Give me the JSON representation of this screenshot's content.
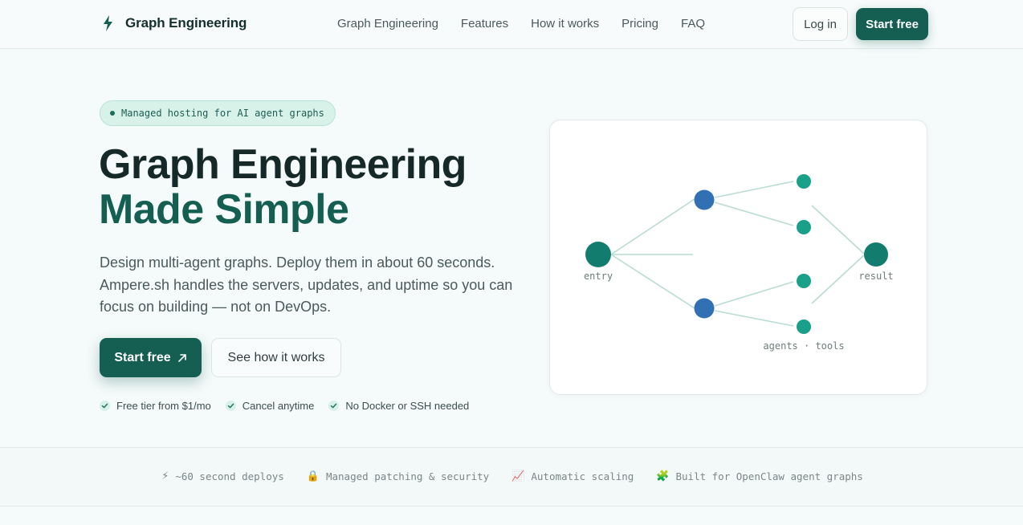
{
  "header": {
    "brand": "Graph Engineering",
    "nav": [
      "Graph Engineering",
      "Features",
      "How it works",
      "Pricing",
      "FAQ"
    ],
    "login_label": "Log in",
    "start_label": "Start free"
  },
  "hero": {
    "badge": "Managed hosting for AI agent graphs",
    "title_line1": "Graph Engineering",
    "title_line2": "Made Simple",
    "description": "Design multi-agent graphs. Deploy them in about 60 seconds. Ampere.sh handles the servers, updates, and uptime so you can focus on building — not on DevOps.",
    "cta_primary": "Start free",
    "cta_secondary": "See how it works",
    "checks": [
      "Free tier from $1/mo",
      "Cancel anytime",
      "No Docker or SSH needed"
    ]
  },
  "graph": {
    "entry_label": "entry",
    "result_label": "result",
    "caption": "agents · tools"
  },
  "features": [
    {
      "icon": "⚡",
      "label": "~60 second deploys"
    },
    {
      "icon": "🔒",
      "label": "Managed patching & security"
    },
    {
      "icon": "📈",
      "label": "Automatic scaling"
    },
    {
      "icon": "🧩",
      "label": "Built for OpenClaw agent graphs"
    }
  ],
  "colors": {
    "primary": "#145f52",
    "agent_node": "#3070b3",
    "tool_node": "#1aa08a",
    "edge": "#b9dcd3"
  }
}
